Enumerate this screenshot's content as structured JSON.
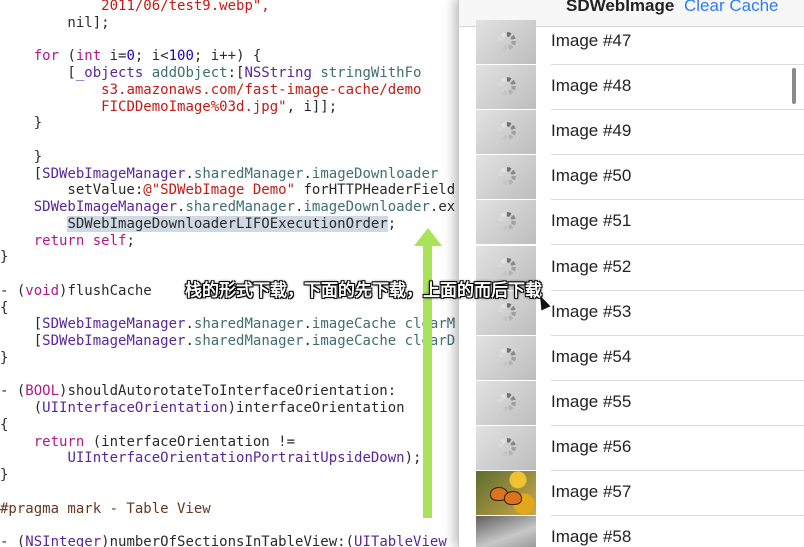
{
  "code_lines": [
    {
      "tokens": [
        {
          "t": "            ",
          "c": "plain"
        },
        {
          "t": "2011/06/test9.webp\",",
          "c": "str"
        }
      ]
    },
    {
      "tokens": [
        {
          "t": "        nil];",
          "c": "plain"
        }
      ]
    },
    {
      "tokens": []
    },
    {
      "tokens": [
        {
          "t": "    ",
          "c": "plain"
        },
        {
          "t": "for",
          "c": "kw"
        },
        {
          "t": " (",
          "c": "plain"
        },
        {
          "t": "int",
          "c": "kw"
        },
        {
          "t": " i=",
          "c": "plain"
        },
        {
          "t": "0",
          "c": "num"
        },
        {
          "t": "; i<",
          "c": "plain"
        },
        {
          "t": "100",
          "c": "num"
        },
        {
          "t": "; i++) {",
          "c": "plain"
        }
      ]
    },
    {
      "tokens": [
        {
          "t": "        [",
          "c": "plain"
        },
        {
          "t": "_objects",
          "c": "cls"
        },
        {
          "t": " ",
          "c": "plain"
        },
        {
          "t": "addObject",
          "c": "fn"
        },
        {
          "t": ":[",
          "c": "plain"
        },
        {
          "t": "NSString",
          "c": "cls"
        },
        {
          "t": " ",
          "c": "plain"
        },
        {
          "t": "stringWithFo",
          "c": "fn"
        }
      ]
    },
    {
      "tokens": [
        {
          "t": "            ",
          "c": "plain"
        },
        {
          "t": "s3.amazonaws.com/fast-image-cache/demo",
          "c": "str"
        }
      ]
    },
    {
      "tokens": [
        {
          "t": "            ",
          "c": "plain"
        },
        {
          "t": "FICDDemoImage%03d.jpg\"",
          "c": "str"
        },
        {
          "t": ", i]];",
          "c": "plain"
        }
      ]
    },
    {
      "tokens": [
        {
          "t": "    }",
          "c": "plain"
        }
      ]
    },
    {
      "tokens": []
    },
    {
      "tokens": [
        {
          "t": "    }",
          "c": "plain"
        }
      ]
    },
    {
      "tokens": [
        {
          "t": "    [",
          "c": "plain"
        },
        {
          "t": "SDWebImageManager",
          "c": "cls"
        },
        {
          "t": ".",
          "c": "plain"
        },
        {
          "t": "sharedManager",
          "c": "fn"
        },
        {
          "t": ".",
          "c": "plain"
        },
        {
          "t": "imageDownloader",
          "c": "fn"
        }
      ]
    },
    {
      "tokens": [
        {
          "t": "        setValue:",
          "c": "plain"
        },
        {
          "t": "@\"SDWebImage Demo\"",
          "c": "str"
        },
        {
          "t": " forHTTPHeaderField",
          "c": "plain"
        }
      ]
    },
    {
      "tokens": [
        {
          "t": "    ",
          "c": "plain"
        },
        {
          "t": "SDWebImageManager",
          "c": "cls"
        },
        {
          "t": ".",
          "c": "plain"
        },
        {
          "t": "sharedManager",
          "c": "fn"
        },
        {
          "t": ".",
          "c": "plain"
        },
        {
          "t": "imageDownloader",
          "c": "fn"
        },
        {
          "t": ".ex",
          "c": "plain"
        }
      ]
    },
    {
      "tokens": [
        {
          "t": "        ",
          "c": "plain"
        },
        {
          "t": "SDWebImageDownloaderLIFOExecutionOrder",
          "c": "hl"
        },
        {
          "t": ";",
          "c": "plain"
        }
      ]
    },
    {
      "tokens": [
        {
          "t": "    ",
          "c": "plain"
        },
        {
          "t": "return",
          "c": "kw"
        },
        {
          "t": " ",
          "c": "plain"
        },
        {
          "t": "self",
          "c": "kw"
        },
        {
          "t": ";",
          "c": "plain"
        }
      ]
    },
    {
      "tokens": [
        {
          "t": "}",
          "c": "plain"
        }
      ]
    },
    {
      "tokens": []
    },
    {
      "tokens": [
        {
          "t": "- (",
          "c": "plain"
        },
        {
          "t": "void",
          "c": "kw"
        },
        {
          "t": ")flushCache",
          "c": "plain"
        }
      ]
    },
    {
      "tokens": [
        {
          "t": "{",
          "c": "plain"
        }
      ]
    },
    {
      "tokens": [
        {
          "t": "    [",
          "c": "plain"
        },
        {
          "t": "SDWebImageManager",
          "c": "cls"
        },
        {
          "t": ".",
          "c": "plain"
        },
        {
          "t": "sharedManager",
          "c": "fn"
        },
        {
          "t": ".",
          "c": "plain"
        },
        {
          "t": "imageCache",
          "c": "fn"
        },
        {
          "t": " ",
          "c": "plain"
        },
        {
          "t": "clearM",
          "c": "fn"
        }
      ]
    },
    {
      "tokens": [
        {
          "t": "    [",
          "c": "plain"
        },
        {
          "t": "SDWebImageManager",
          "c": "cls"
        },
        {
          "t": ".",
          "c": "plain"
        },
        {
          "t": "sharedManager",
          "c": "fn"
        },
        {
          "t": ".",
          "c": "plain"
        },
        {
          "t": "imageCache",
          "c": "fn"
        },
        {
          "t": " ",
          "c": "plain"
        },
        {
          "t": "clearD",
          "c": "fn"
        }
      ]
    },
    {
      "tokens": [
        {
          "t": "}",
          "c": "plain"
        }
      ]
    },
    {
      "tokens": []
    },
    {
      "tokens": [
        {
          "t": "- (",
          "c": "plain"
        },
        {
          "t": "BOOL",
          "c": "kw"
        },
        {
          "t": ")shouldAutorotateToInterfaceOrientation:",
          "c": "plain"
        }
      ]
    },
    {
      "tokens": [
        {
          "t": "    (",
          "c": "plain"
        },
        {
          "t": "UIInterfaceOrientation",
          "c": "cls"
        },
        {
          "t": ")interfaceOrientation",
          "c": "plain"
        }
      ]
    },
    {
      "tokens": [
        {
          "t": "{",
          "c": "plain"
        }
      ]
    },
    {
      "tokens": [
        {
          "t": "    ",
          "c": "plain"
        },
        {
          "t": "return",
          "c": "kw"
        },
        {
          "t": " (interfaceOrientation !=",
          "c": "plain"
        }
      ]
    },
    {
      "tokens": [
        {
          "t": "        ",
          "c": "plain"
        },
        {
          "t": "UIInterfaceOrientationPortraitUpsideDown",
          "c": "cls"
        },
        {
          "t": ");",
          "c": "plain"
        }
      ]
    },
    {
      "tokens": [
        {
          "t": "}",
          "c": "plain"
        }
      ]
    },
    {
      "tokens": []
    },
    {
      "tokens": [
        {
          "t": "#pragma mark - Table View",
          "c": "prep"
        }
      ]
    },
    {
      "tokens": []
    },
    {
      "tokens": [
        {
          "t": "- (",
          "c": "plain"
        },
        {
          "t": "NSInteger",
          "c": "cls"
        },
        {
          "t": ")numberOfSectionsInTableView:(",
          "c": "plain"
        },
        {
          "t": "UITableView",
          "c": "cls"
        }
      ]
    }
  ],
  "subtitle": "栈的形式下载，下面的先下载，上面的而后下载",
  "simulator": {
    "nav_title": "SDWebImage",
    "nav_button": "Clear Cache",
    "rows": [
      {
        "label": "Image #47",
        "thumb": "loading-spinner-icon"
      },
      {
        "label": "Image #48",
        "thumb": "loading-spinner-icon"
      },
      {
        "label": "Image #49",
        "thumb": "loading-spinner-icon"
      },
      {
        "label": "Image #50",
        "thumb": "loading-spinner-icon"
      },
      {
        "label": "Image #51",
        "thumb": "loading-spinner-icon"
      },
      {
        "label": "Image #52",
        "thumb": "loading-spinner-icon"
      },
      {
        "label": "Image #53",
        "thumb": "loading-spinner-icon"
      },
      {
        "label": "Image #54",
        "thumb": "loading-spinner-icon"
      },
      {
        "label": "Image #55",
        "thumb": "loading-spinner-icon"
      },
      {
        "label": "Image #56",
        "thumb": "loading-spinner-icon"
      },
      {
        "label": "Image #57",
        "thumb": "butterfly-photo"
      },
      {
        "label": "Image #58",
        "thumb": "grayscale-photo"
      }
    ]
  },
  "colors": {
    "arrow": "#a9e35a",
    "accent": "#2f7cf6",
    "keyword": "#b21889",
    "string": "#c41a16"
  }
}
